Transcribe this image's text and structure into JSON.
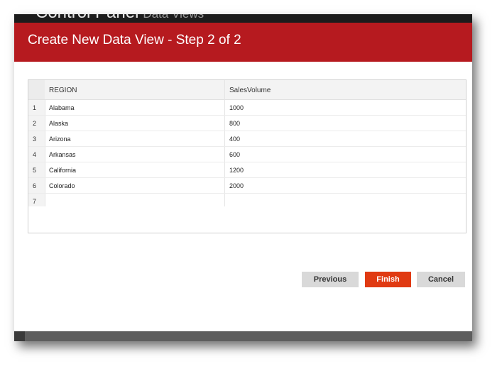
{
  "background": {
    "app_title": "Control Panel",
    "app_subtitle": "Data Views"
  },
  "dialog": {
    "title": "Create New Data View - Step 2 of 2",
    "accent_color": "#b61a1f"
  },
  "grid": {
    "columns": [
      "REGION",
      "SalesVolume"
    ],
    "rows": [
      {
        "num": "1",
        "region": "Alabama",
        "sales": "1000"
      },
      {
        "num": "2",
        "region": "Alaska",
        "sales": "800"
      },
      {
        "num": "3",
        "region": "Arizona",
        "sales": "400"
      },
      {
        "num": "4",
        "region": "Arkansas",
        "sales": "600"
      },
      {
        "num": "5",
        "region": "California",
        "sales": "1200"
      },
      {
        "num": "6",
        "region": "Colorado",
        "sales": "2000"
      },
      {
        "num": "7",
        "region": "",
        "sales": ""
      }
    ]
  },
  "buttons": {
    "previous": "Previous",
    "finish": "Finish",
    "cancel": "Cancel",
    "finish_color": "#e03a12"
  }
}
